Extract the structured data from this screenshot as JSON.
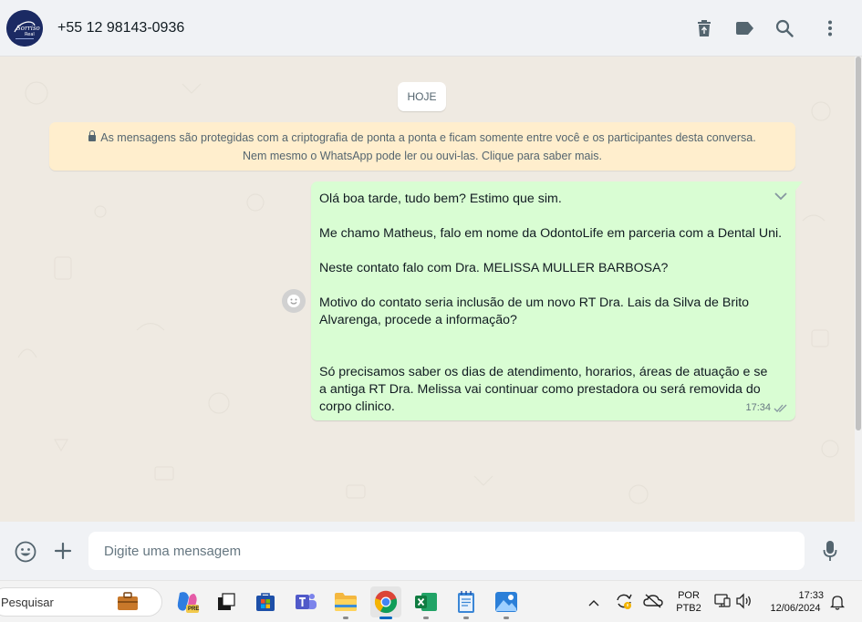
{
  "header": {
    "contact_name": "+55 12 98143-0936",
    "icons": [
      "avatar-logo",
      "trash-icon",
      "label-icon",
      "search-icon",
      "menu-icon"
    ]
  },
  "chat": {
    "date_label": "HOJE",
    "encryption_notice": "As mensagens são protegidas com a criptografia de ponta a ponta e ficam somente entre você e os participantes desta conversa. Nem mesmo o WhatsApp pode ler ou ouvi-las. Clique para saber mais.",
    "message": {
      "lines": [
        "Olá boa tarde, tudo bem? Estimo que sim.",
        "Me chamo Matheus, falo em nome da OdontoLife em parceria com a Dental Uni.",
        "Neste contato falo com Dra. MELISSA MULLER BARBOSA?",
        "Motivo do contato seria inclusão de um novo RT Dra. Lais da Silva de Brito Alvarenga, procede a informação?",
        "Só precisamos saber os dias de atendimento, horarios, áreas de atuação e se a antiga RT Dra. Melissa vai continuar como prestadora ou será removida do corpo clinico."
      ],
      "time": "17:34"
    }
  },
  "composer": {
    "placeholder": "Digite uma mensagem"
  },
  "taskbar": {
    "search_label": "Pesquisar",
    "lang_top": "POR",
    "lang_bottom": "PTB2",
    "time": "17:33",
    "date": "12/06/2024",
    "copilot_badge": "PRE"
  },
  "colors": {
    "bubble_out": "#d9fdd3",
    "notice_bg": "#ffeecd",
    "chat_bg": "#efeae2",
    "header_bg": "#f0f2f5",
    "accent": "#0067c0"
  }
}
